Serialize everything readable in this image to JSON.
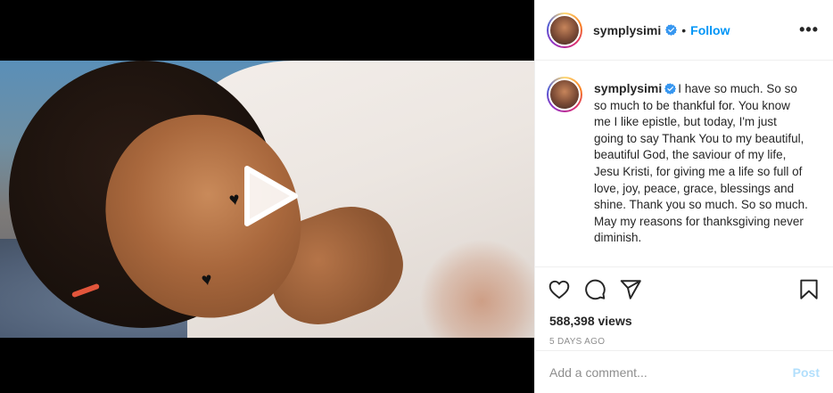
{
  "post": {
    "username": "symplysimi",
    "verified_icon": "verified-badge-icon",
    "follow_label": "Follow",
    "separator": "•",
    "more_label": "•••",
    "caption": "I have so much. So so so much to be thankful for. You know me I like epistle, but today, I'm just going to say Thank You to my beautiful, beautiful God, the saviour of my life, Jesu Kristi, for giving me a life so full of love, joy, peace, grace, blessings and shine. Thank you so much. So so much. May my reasons for thanksgiving never diminish.",
    "views": "588,398 views",
    "time_ago": "5 DAYS AGO",
    "comment_placeholder": "Add a comment...",
    "post_label": "Post"
  },
  "colors": {
    "accent_blue": "#0095f6",
    "post_disabled": "#b2dffc",
    "verified": "#3897f0"
  },
  "icons": [
    "heart-icon",
    "comment-icon",
    "share-icon",
    "bookmark-icon",
    "play-icon"
  ]
}
